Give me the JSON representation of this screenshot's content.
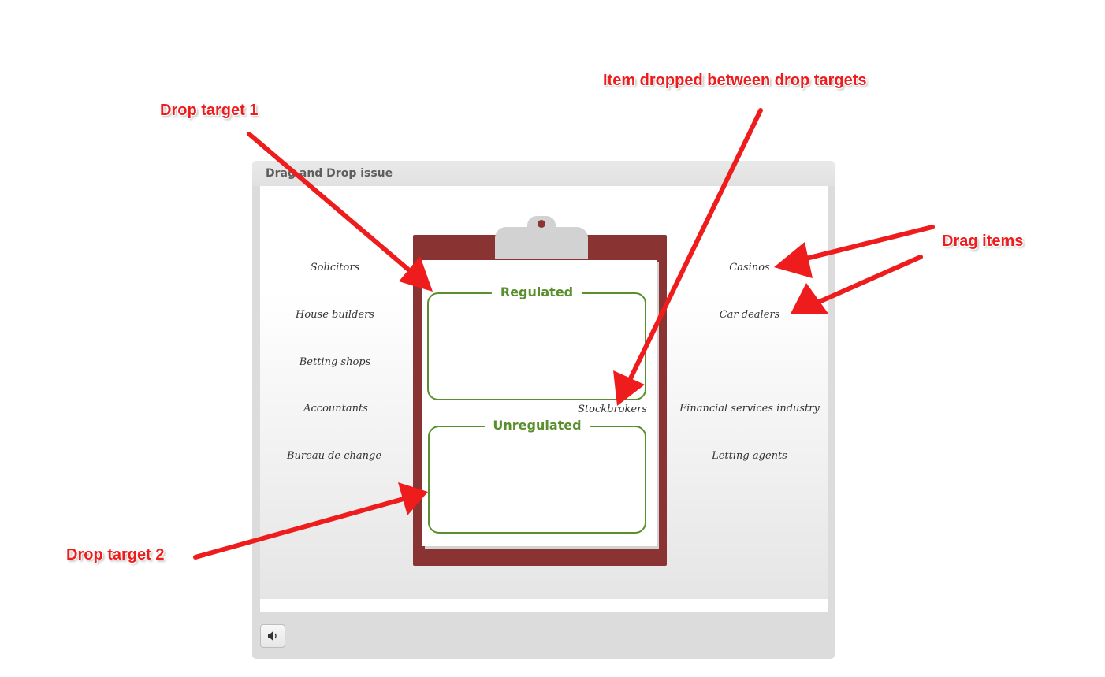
{
  "player": {
    "title": "Drag and Drop issue"
  },
  "clipboard": {
    "targets": [
      {
        "label": "Regulated"
      },
      {
        "label": "Unregulated"
      }
    ]
  },
  "drag_items": {
    "left": [
      "Solicitors",
      "House builders",
      "Betting shops",
      "Accountants",
      "Bureau de change"
    ],
    "right": [
      "Casinos",
      "Car dealers",
      "Financial services industry",
      "Letting agents"
    ],
    "dropped": "Stockbrokers"
  },
  "footer": {
    "audio_icon": "speaker-icon"
  },
  "annotations": {
    "drop_target_1": "Drop target 1",
    "drop_target_2": "Drop target 2",
    "item_dropped": "Item dropped between drop targets",
    "drag_items": "Drag items"
  },
  "colors": {
    "clipboard": "#8a3333",
    "target_border": "#5a8f2e",
    "annotation": "#ee1c1c"
  }
}
